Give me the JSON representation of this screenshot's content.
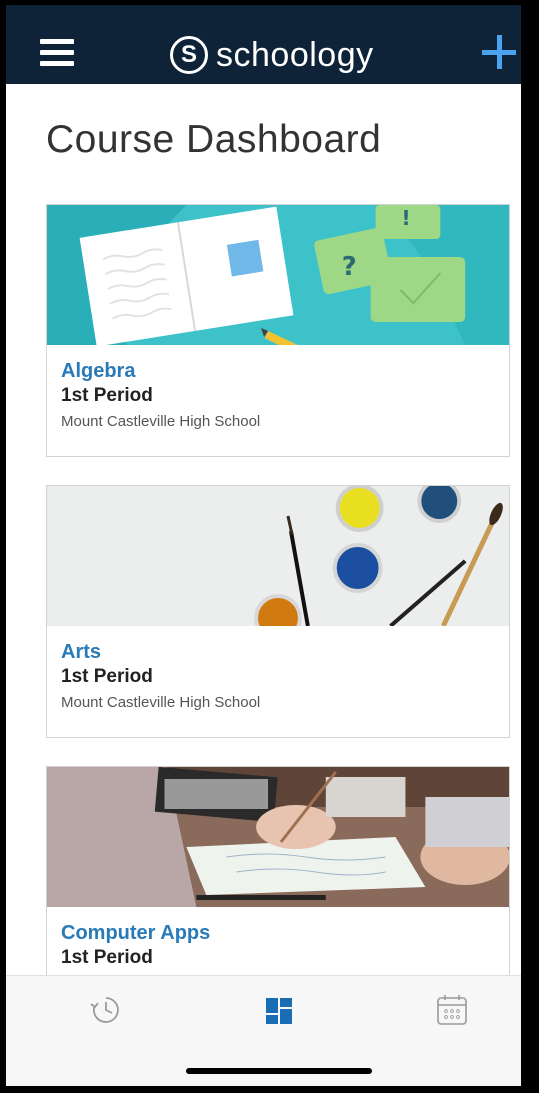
{
  "header": {
    "brand_mark": "S",
    "brand_name": "schoology"
  },
  "page": {
    "title": "Course Dashboard"
  },
  "courses": [
    {
      "name": "Algebra",
      "period": "1st Period",
      "school": "Mount Castleville High School",
      "image": "notebook-speech-bubbles-illustration"
    },
    {
      "name": "Arts",
      "period": "1st Period",
      "school": "Mount Castleville High School",
      "image": "paint-pots-and-brushes-photo"
    },
    {
      "name": "Computer Apps",
      "period": "1st Period",
      "school": "",
      "image": "laptop-and-paperwork-photo"
    }
  ],
  "tabs": [
    {
      "name": "recent-activity",
      "icon": "clock-icon",
      "active": false
    },
    {
      "name": "courses",
      "icon": "grid-icon",
      "active": true
    },
    {
      "name": "calendar",
      "icon": "calendar-icon",
      "active": false
    }
  ],
  "colors": {
    "header_bg": "#0f2338",
    "accent": "#4aa3ee",
    "course_link": "#2a7ab8",
    "active_tab": "#1a6cb5"
  }
}
